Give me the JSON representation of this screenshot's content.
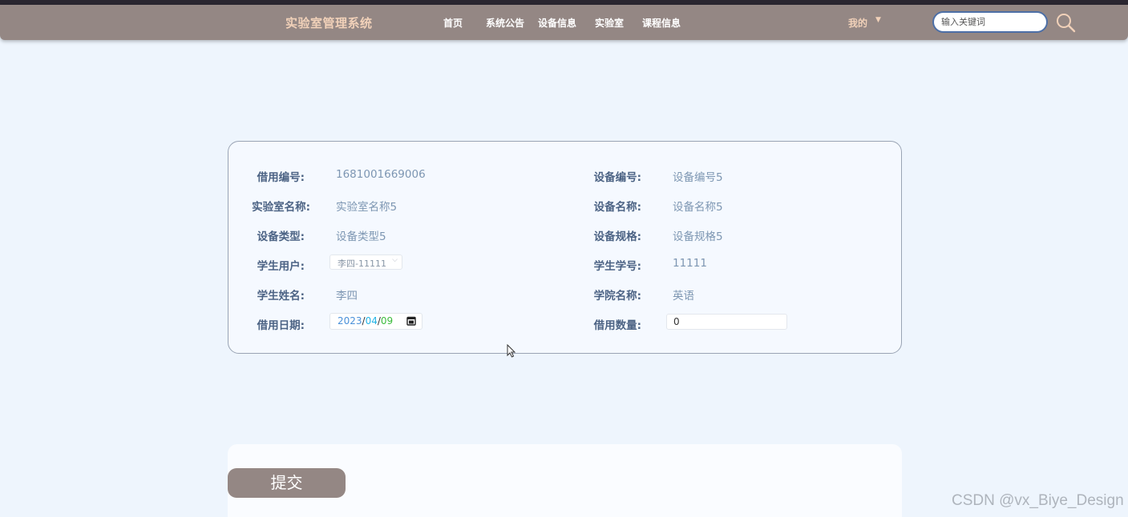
{
  "navbar": {
    "brand": "实验室管理系统",
    "items": [
      {
        "label": "首页"
      },
      {
        "label": "系统公告"
      },
      {
        "label": "设备信息"
      },
      {
        "label": "实验室"
      },
      {
        "label": "课程信息"
      }
    ],
    "mine_label": "我的",
    "search_placeholder": "输入关键词"
  },
  "form": {
    "borrow_no": {
      "label": "借用编号:",
      "value": "1681001669006"
    },
    "lab_name": {
      "label": "实验室名称:",
      "value": "实验室名称5"
    },
    "device_type": {
      "label": "设备类型:",
      "value": "设备类型5"
    },
    "student_user": {
      "label": "学生用户:",
      "value": "李四-11111"
    },
    "student_name": {
      "label": "学生姓名:",
      "value": "李四"
    },
    "borrow_date": {
      "label": "借用日期:",
      "year": "2023",
      "month": "04",
      "day": "09",
      "sep": "/"
    },
    "device_no": {
      "label": "设备编号:",
      "value": "设备编号5"
    },
    "device_name": {
      "label": "设备名称:",
      "value": "设备名称5"
    },
    "device_spec": {
      "label": "设备规格:",
      "value": "设备规格5"
    },
    "student_no": {
      "label": "学生学号:",
      "value": "11111"
    },
    "college_name": {
      "label": "学院名称:",
      "value": "英语"
    },
    "borrow_qty": {
      "label": "借用数量:",
      "value": "0"
    }
  },
  "submit_label": "提交",
  "watermark": "CSDN @vx_Biye_Design",
  "colors": {
    "navbar_bg": "#948784",
    "brand": "#f1d1b9",
    "label": "#4c6384",
    "value": "#7d96b2",
    "page_bg": "#eef5fd"
  }
}
